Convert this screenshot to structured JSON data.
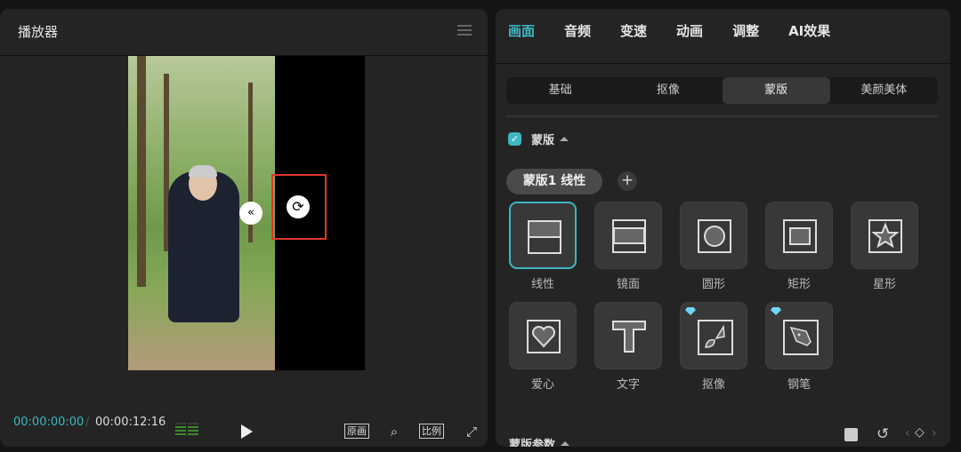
{
  "player": {
    "title": "播放器",
    "current_time": "00:00:00:00",
    "separator": "/",
    "duration": "00:00:12:16",
    "btn_original": "原画",
    "btn_ratio": "比例",
    "icons": [
      "menu-icon",
      "feather-icon",
      "rotate-icon",
      "play-icon",
      "zoom-fit-icon",
      "fullscreen-icon",
      "audio-meter-icon"
    ]
  },
  "inspector": {
    "tabs": [
      {
        "label": "画面",
        "active": true
      },
      {
        "label": "音频"
      },
      {
        "label": "变速"
      },
      {
        "label": "动画"
      },
      {
        "label": "调整"
      },
      {
        "label": "AI效果"
      }
    ],
    "subtabs": [
      {
        "label": "基础"
      },
      {
        "label": "抠像"
      },
      {
        "label": "蒙版",
        "active": true
      },
      {
        "label": "美颜美体"
      }
    ],
    "mask_section": {
      "label": "蒙版",
      "enabled": true
    },
    "mask_pill": "蒙版1 线性",
    "shapes": [
      {
        "label": "线性",
        "selected": true
      },
      {
        "label": "镜面"
      },
      {
        "label": "圆形"
      },
      {
        "label": "矩形"
      },
      {
        "label": "星形"
      },
      {
        "label": "爱心"
      },
      {
        "label": "文字"
      },
      {
        "label": "抠像",
        "premium": true
      },
      {
        "label": "钢笔",
        "premium": true
      }
    ],
    "params_label": "蒙版参数"
  },
  "colors": {
    "accent": "#3fb6c4",
    "highlight_box": "#e0352b"
  }
}
